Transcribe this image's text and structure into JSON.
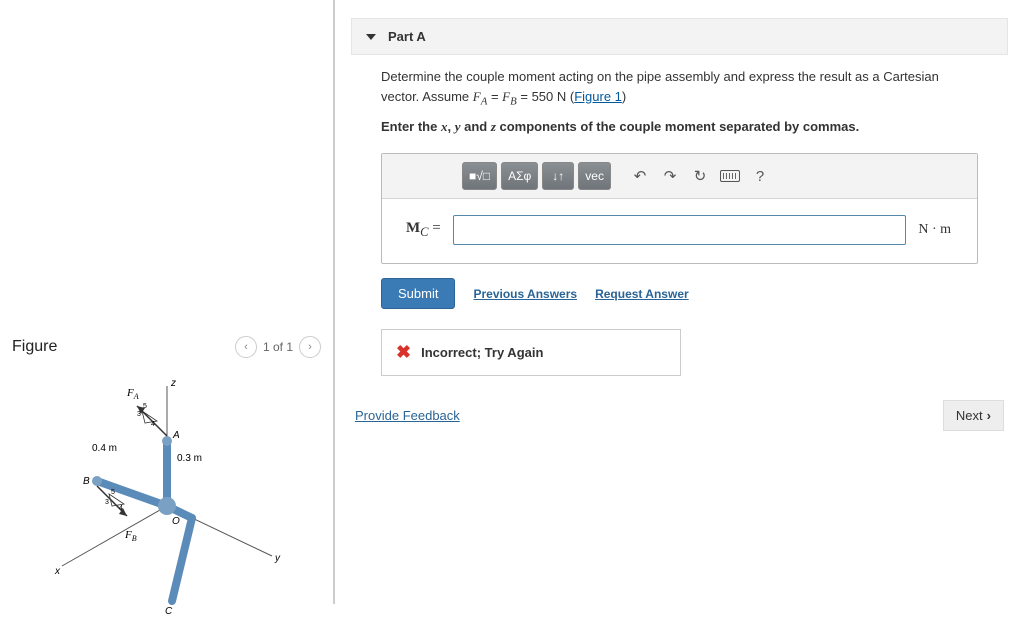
{
  "figure": {
    "title": "Figure",
    "nav_text": "1 of 1",
    "labels": {
      "FA": "F",
      "FA_sub": "A",
      "FB": "F",
      "FB_sub": "B",
      "dim1": "0.4 m",
      "dim2": "0.3 m",
      "axis_x": "x",
      "axis_y": "y",
      "axis_z": "z",
      "pointA": "A",
      "pointB": "B",
      "pointO": "O",
      "pointC": "C",
      "ratio_3": "3",
      "ratio_4": "4",
      "ratio_5": "5"
    }
  },
  "part": {
    "title": "Part A",
    "prompt_pre": "Determine the couple moment acting on the pipe assembly and express the result as a Cartesian vector. Assume ",
    "eq_FA": "F",
    "eq_FA_sub": "A",
    "eq_eq1": " = ",
    "eq_FB": "F",
    "eq_FB_sub": "B",
    "eq_val": " = 550 N (",
    "fig_link": "Figure 1",
    "prompt_post": ")",
    "sub_prompt_pre": "Enter the ",
    "var_x": "x",
    "var_y": "y",
    "var_z": "z",
    "sub_prompt_mid1": ", ",
    "sub_prompt_mid2": " and ",
    "sub_prompt_post": " components of the couple moment separated by commas.",
    "answer_label_pre": "M",
    "answer_label_sub": "C",
    "answer_label_post": " =",
    "unit": "N · m",
    "toolbar": {
      "templates": "■√□",
      "greek": "ΑΣφ",
      "arrows": "↓↑",
      "vec": "vec",
      "undo": "↶",
      "redo": "↷",
      "reset": "↻",
      "help": "?"
    },
    "submit": "Submit",
    "prev_answers": "Previous Answers",
    "req_answer": "Request Answer",
    "incorrect": "Incorrect; Try Again"
  },
  "footer": {
    "provide_feedback": "Provide Feedback",
    "next": "Next"
  }
}
